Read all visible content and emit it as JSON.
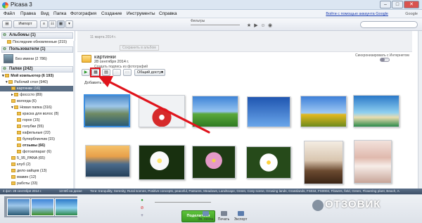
{
  "window": {
    "title": "Picasa 3",
    "btn_min": "–",
    "btn_max": "□",
    "btn_close": "✕"
  },
  "menu": {
    "items": [
      "Файл",
      "Правка",
      "Вид",
      "Папка",
      "Фотография",
      "Создание",
      "Инструменты",
      "Справка"
    ],
    "signin": "Войти с помощью аккаунта Google",
    "close_hint": "Google"
  },
  "toolbar": {
    "import_label": "Импорт",
    "filters_label": "Фильтры"
  },
  "sidebar": {
    "albums_header": "Альбомы (1)",
    "albums_item": "Последние обновленные (215)",
    "people_header": "Пользователи (1)",
    "people_item": "Без имени (2 786)",
    "folders_header": "Папки (242)",
    "tree": [
      "Мой компьютер (6 193)",
      "Рабочий стол (940)",
      "картинки (16)",
      "фосссто (89)",
      "вологда (6)",
      "Новая папка (316)",
      "краска для волос (8)",
      "горох (15)",
      "голубки (55)",
      "кафельные (22)",
      "булерблинчик (15)",
      "отзывы (66)",
      "фотоаппарат (6)",
      "5_95_PANA (65)",
      "клуб (2)",
      "дело-зайцев (13)",
      "мамин (12)",
      "работы (33)"
    ]
  },
  "album": {
    "title": "картинки",
    "date": "28 сентября 2014 г.",
    "link": "Создать подпись из фотографий",
    "sync": "Синхронизировать с Интернетом",
    "share": "Общий доступ",
    "add_caption": "Добавить опи"
  },
  "topstrip": {
    "labels": [
      "11 марта 2014 г.",
      "",
      "Сохранить в альбом"
    ]
  },
  "statusbar": {
    "left": "4 фот.   28 сентября 2014 г.",
    "size": "13 Мб на диске",
    "tags": "Теги: tranquility, Serenity, Rural scenes, Positive concepts, peaceful, Pastures, Meadows, Landscape, Green, Cosy scene, Growing lands, Grasslands, FS034, FS0004, Flowers, field, Green, Flowering plant, Beach, Agriculture, Bushes, Agricultural lands, 1440x1426"
  },
  "tray": {
    "share_btn": "Поделиться",
    "actions": [
      "Эл. почта",
      "Печать",
      "Экспорт"
    ]
  },
  "watermark": "ОТЗОВИК",
  "colors": {
    "accent": "#3b8de0",
    "highlight": "#e0141c",
    "share_green": "#3a9a22"
  }
}
